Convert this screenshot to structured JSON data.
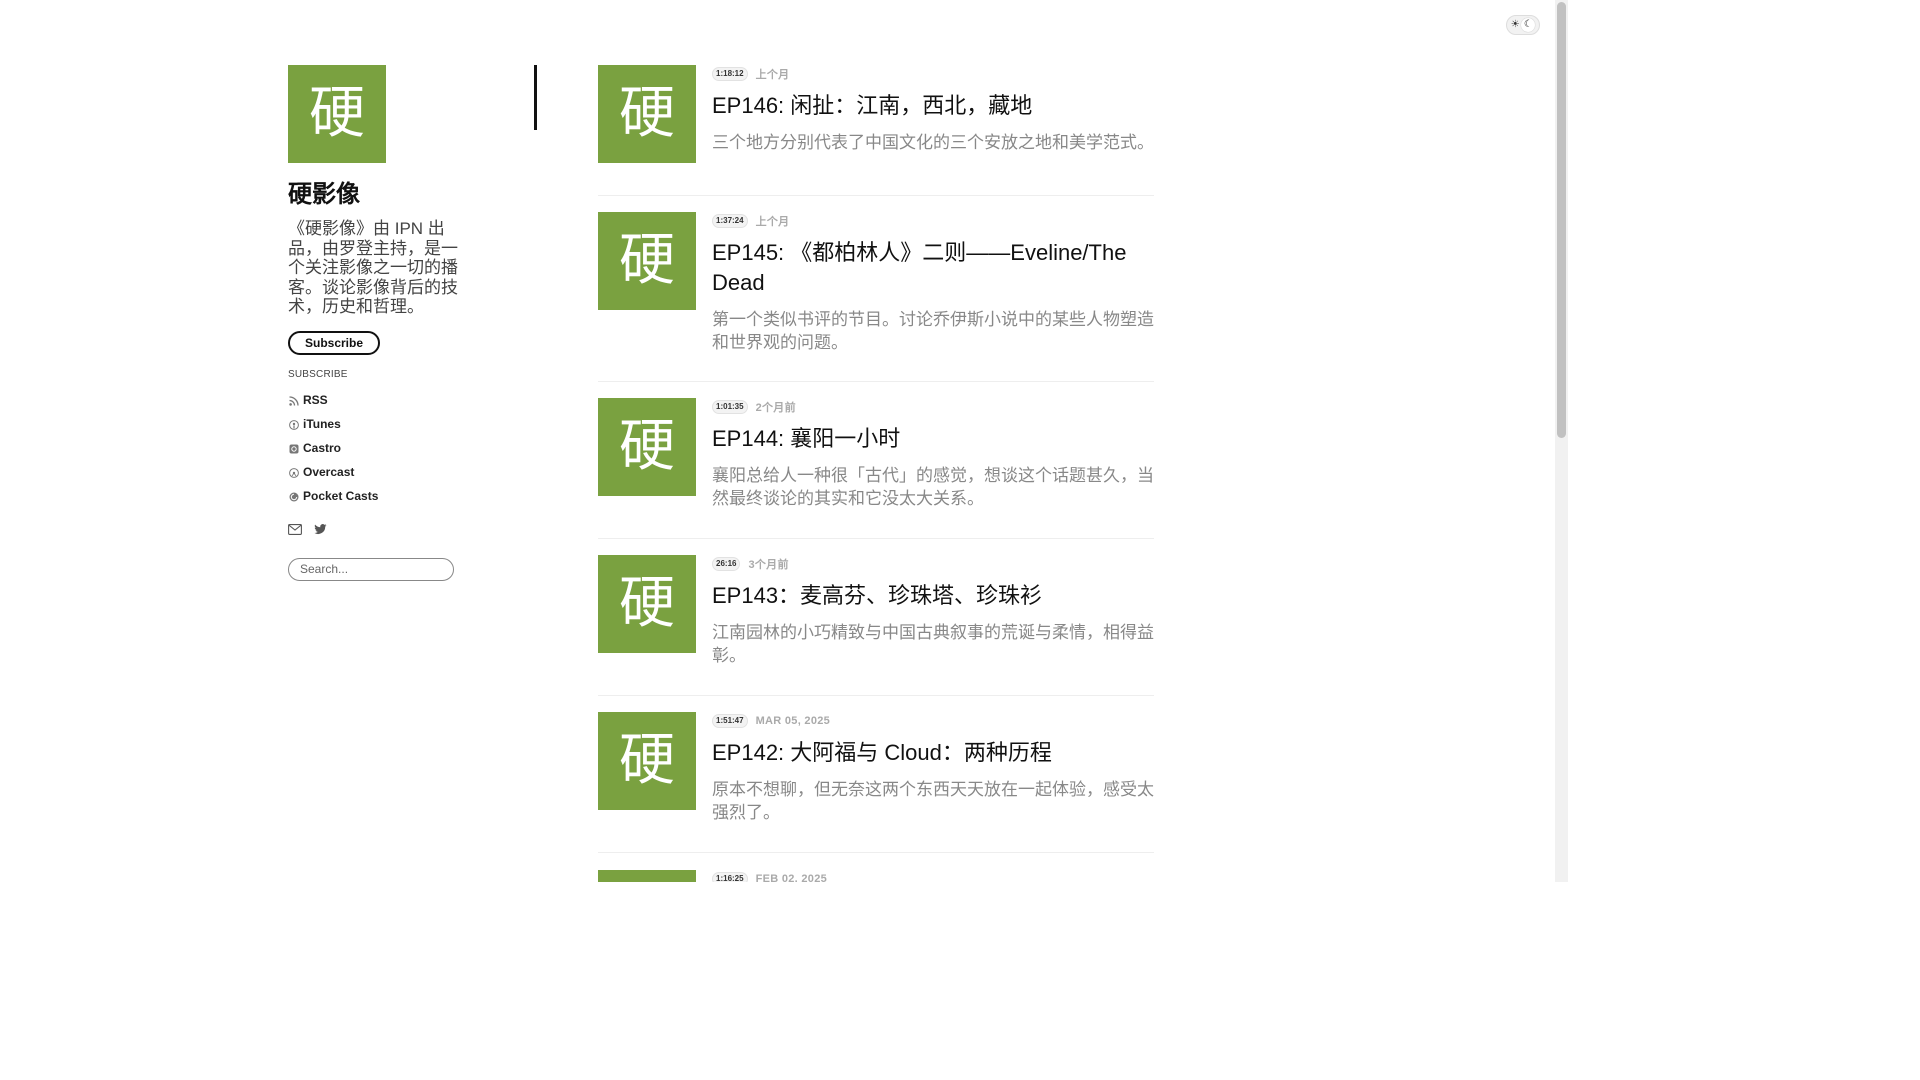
{
  "theme": {
    "sun_icon": "sun-icon",
    "moon_icon": "moon-icon"
  },
  "colors": {
    "accent_green": "#7aa140",
    "text": "#222222",
    "muted": "#888888"
  },
  "sidebar": {
    "logo_char": "硬",
    "title": "硬影像",
    "description": "《硬影像》由 IPN 出品，由罗登主持，是一个关注影像之一切的播客。谈论影像背后的技术，历史和哲理。",
    "subscribe_button": "Subscribe",
    "subscribe_heading": "SUBSCRIBE",
    "feeds": [
      {
        "label": "RSS",
        "icon": "rss-icon"
      },
      {
        "label": "iTunes",
        "icon": "podcast-icon"
      },
      {
        "label": "Castro",
        "icon": "castro-icon"
      },
      {
        "label": "Overcast",
        "icon": "overcast-icon"
      },
      {
        "label": "Pocket Casts",
        "icon": "pocket-casts-icon"
      }
    ],
    "social": [
      {
        "icon": "email-icon"
      },
      {
        "icon": "twitter-icon"
      }
    ],
    "search_placeholder": "Search..."
  },
  "episodes": [
    {
      "cover_char": "硬",
      "duration": "1:18:12",
      "date": "上个月",
      "title": "EP146: 闲扯：江南，西北，藏地",
      "description": "三个地方分别代表了中国文化的三个安放之地和美学范式。"
    },
    {
      "cover_char": "硬",
      "duration": "1:37:24",
      "date": "上个月",
      "title": "EP145: 《都柏林人》二则——Eveline/The Dead",
      "description": "第一个类似书评的节目。讨论乔伊斯小说中的某些人物塑造和世界观的问题。"
    },
    {
      "cover_char": "硬",
      "duration": "1:01:35",
      "date": "2个月前",
      "title": "EP144: 襄阳一小时",
      "description": "襄阳总给人一种很「古代」的感觉，想谈这个话题甚久，当然最终谈论的其实和它没太大关系。"
    },
    {
      "cover_char": "硬",
      "duration": "26:16",
      "date": "3个月前",
      "title": "EP143：麦高芬、珍珠塔、珍珠衫",
      "description": "江南园林的小巧精致与中国古典叙事的荒诞与柔情，相得益彰。"
    },
    {
      "cover_char": "硬",
      "duration": "1:51:47",
      "date": "MAR 05, 2025",
      "title": "EP142: 大阿福与 Cloud：两种历程",
      "description": "原本不想聊，但无奈这两个东西天天放在一起体验，感受太强烈了。"
    },
    {
      "cover_char": "硬",
      "duration": "1:16:25",
      "date": "FEB 02, 2025",
      "title": "",
      "description": ""
    }
  ]
}
